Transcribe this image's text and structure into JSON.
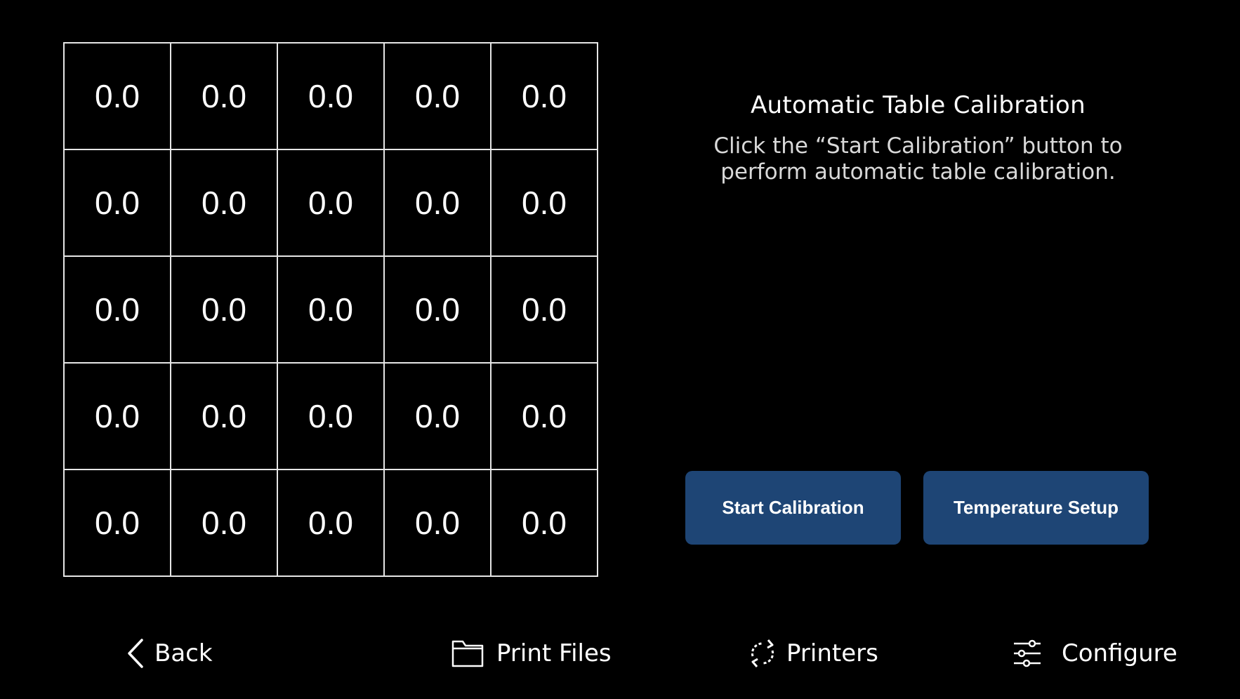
{
  "mesh": {
    "rows": [
      [
        "0.0",
        "0.0",
        "0.0",
        "0.0",
        "0.0"
      ],
      [
        "0.0",
        "0.0",
        "0.0",
        "0.0",
        "0.0"
      ],
      [
        "0.0",
        "0.0",
        "0.0",
        "0.0",
        "0.0"
      ],
      [
        "0.0",
        "0.0",
        "0.0",
        "0.0",
        "0.0"
      ],
      [
        "0.0",
        "0.0",
        "0.0",
        "0.0",
        "0.0"
      ]
    ]
  },
  "panel": {
    "title": "Automatic Table Calibration",
    "description": "Click the “Start Calibration” button to perform automatic table calibration."
  },
  "actions": {
    "start_label": "Start Calibration",
    "temperature_label": "Temperature Setup"
  },
  "nav": {
    "back_label": "Back",
    "files_label": "Print Files",
    "printers_label": "Printers",
    "configure_label": "Configure"
  },
  "icons": {
    "back": "chevron-left-icon",
    "files": "folder-icon",
    "printers": "refresh-icon",
    "configure": "sliders-icon"
  },
  "colors": {
    "background": "#000000",
    "button": "#1e4575",
    "grid_line": "#e6e6e6"
  }
}
